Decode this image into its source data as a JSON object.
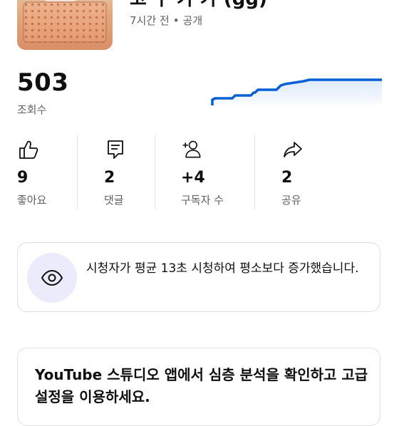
{
  "video": {
    "title": "고 구 가 가 (gg)",
    "time": "7시간 전",
    "separator": "•",
    "visibility": "공개"
  },
  "views": {
    "value": "503",
    "label": "조회수",
    "chart_color": "#065fd4"
  },
  "stats": [
    {
      "icon": "thumbs-up-icon",
      "value": "9",
      "label": "좋아요"
    },
    {
      "icon": "comment-icon",
      "value": "2",
      "label": "댓글"
    },
    {
      "icon": "add-subscriber-icon",
      "value": "+4",
      "label": "구독자 수"
    },
    {
      "icon": "share-icon",
      "value": "2",
      "label": "공유"
    }
  ],
  "insight": {
    "icon": "eye-icon",
    "text": "시청자가 평균 13초 시청하여 평소보다 증가했습니다."
  },
  "promo": {
    "text": "YouTube 스튜디오 앱에서 심층 분석을 확인하고 고급 설정을 이용하세요."
  }
}
